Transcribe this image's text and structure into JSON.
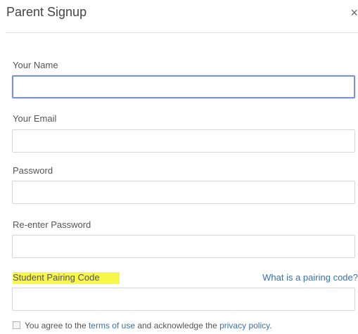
{
  "dialog": {
    "title": "Parent Signup",
    "close_symbol": "×"
  },
  "form": {
    "name_label": "Your Name",
    "name_value": "",
    "email_label": "Your Email",
    "email_value": "",
    "password_label": "Password",
    "password_value": "",
    "reenter_label": "Re-enter Password",
    "reenter_value": "",
    "pairing_label": "Student Pairing Code",
    "pairing_help_link": "What is a pairing code?",
    "pairing_value": ""
  },
  "agreement": {
    "text_1": "You agree to the ",
    "terms_link": "terms of use",
    "text_2": " and acknowledge the ",
    "privacy_link": "privacy policy",
    "text_3": ".",
    "checked": false
  },
  "colors": {
    "link": "#3e6fa8",
    "highlight": "#f7f74a",
    "focus_border": "#7b93d6"
  }
}
